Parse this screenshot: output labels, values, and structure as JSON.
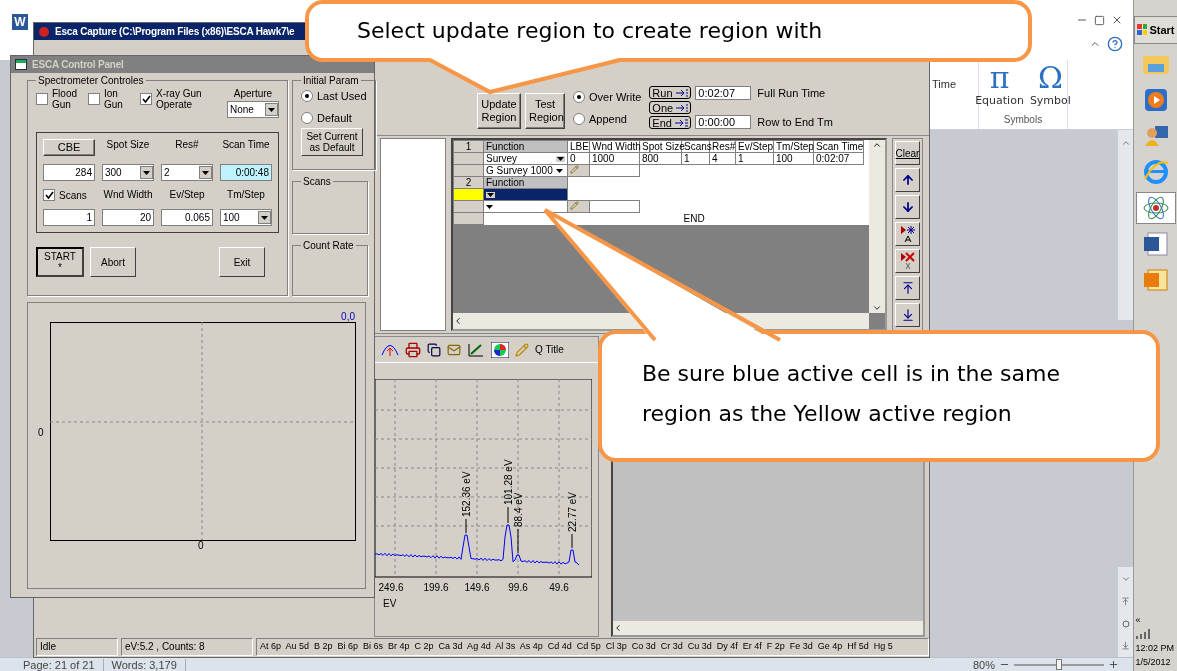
{
  "word": {
    "app_glyph": "W",
    "ribbon": {
      "partial_label": "Time",
      "buttons": [
        {
          "glyph": "π",
          "label": "Equation"
        },
        {
          "glyph": "Ω",
          "label": "Symbol"
        }
      ],
      "group": "Symbols"
    },
    "status": {
      "page": "Page: 21 of 21",
      "words": "Words: 3,179",
      "zoom": "80%",
      "zoom_slider": {
        "level": 0.5
      }
    }
  },
  "taskbar": {
    "start": "Start",
    "more": "«",
    "clock": {
      "time": "12:02 PM",
      "date": "1/5/2012"
    }
  },
  "capture": {
    "title": "Esca Capture (C:\\Program Files (x86)\\ESCA Hawk7\\e",
    "region_buttons": [
      "Update Region",
      "Test Region"
    ],
    "write_mode": [
      {
        "label": "Over Write",
        "selected": true
      },
      {
        "label": "Append",
        "selected": false
      }
    ],
    "run_buttons": [
      "Run",
      "One",
      "End"
    ],
    "full_run_time": {
      "value": "0:02:07",
      "label": "Full Run Time"
    },
    "row_to_end": {
      "value": "0:00:00",
      "label": "Row to End Tm"
    },
    "grid": {
      "columns": [
        "LBE",
        "Wnd Width",
        "Spot Size",
        "Scans",
        "Res#",
        "Ev/Step",
        "Tm/Step",
        "Scan Time"
      ],
      "regions": [
        {
          "number": "1",
          "header": "Function",
          "active": false,
          "function": "Survey",
          "values": [
            "0",
            "1000",
            "800",
            "1",
            "4",
            "1",
            "100",
            "0:02:07"
          ],
          "file": "G Survey 1000"
        },
        {
          "number": "2",
          "header": "Function",
          "active": true
        }
      ],
      "end": "END"
    },
    "side_buttons": [
      {
        "kind": "text",
        "label": "Clear"
      },
      {
        "kind": "up"
      },
      {
        "kind": "down"
      },
      {
        "kind": "insert"
      },
      {
        "kind": "delete"
      },
      {
        "kind": "top"
      },
      {
        "kind": "bottom"
      }
    ],
    "chart_toolbar": {
      "title_button": "Q Title"
    },
    "spectrum": {
      "peaks": [
        "152.36 eV",
        "101.28 eV",
        "88.4 eV",
        "22.77 eV"
      ],
      "x_ticks": [
        "249.6",
        "199.6",
        "149.6",
        "99.6",
        "49.6"
      ],
      "x_label": "EV"
    },
    "status": {
      "state": "Idle",
      "reading": "eV:5.2 , Counts: 8",
      "elements": "At 6p  Au 5d  B 2p  Bi 6p  Bi 6s  Br 4p  C 2p  Ca 3d  Ag 4d  Al 3s  As 4p  Cd 4d  Cd 5p  Cl 3p  Co 3d  Cr 3d  Cu 3d  Dy 4f  Er 4f  F 2p  Fe 3d  Ge 4p  Hf 5d  Hg 5"
    }
  },
  "control_panel": {
    "title": "ESCA Control Panel",
    "group_title": "Spectrometer Controles",
    "checkboxes": [
      {
        "label": "Flood Gun",
        "checked": false
      },
      {
        "label": "Ion Gun",
        "checked": false
      },
      {
        "label": "X-ray Gun Operate",
        "checked": true
      }
    ],
    "aperture": {
      "label": "Aperture",
      "value": "None"
    },
    "param_headers": [
      {
        "kind": "button",
        "label": "CBE"
      },
      {
        "kind": "text",
        "label": "Spot Size"
      },
      {
        "kind": "text",
        "label": "Res#"
      },
      {
        "kind": "text",
        "label": "Scan Time"
      },
      {
        "kind": "checkbox",
        "label": "Scans",
        "checked": true
      },
      {
        "kind": "text",
        "label": "Wnd Width"
      },
      {
        "kind": "text",
        "label": "Ev/Step"
      },
      {
        "kind": "text",
        "label": "Tm/Step"
      }
    ],
    "param_fields": [
      {
        "kind": "input",
        "value": "284"
      },
      {
        "kind": "select",
        "value": "300"
      },
      {
        "kind": "select",
        "value": "2"
      },
      {
        "kind": "readout",
        "value": "0:00:48"
      },
      {
        "kind": "input",
        "value": "1"
      },
      {
        "kind": "input",
        "value": "20"
      },
      {
        "kind": "input",
        "value": "0.065"
      },
      {
        "kind": "select",
        "value": "100"
      }
    ],
    "actions": [
      {
        "label": "START *",
        "default": true
      },
      {
        "label": "Abort",
        "default": false
      },
      {
        "label": "Exit",
        "default": false
      }
    ],
    "initial_param": {
      "title": "Initial Param",
      "options": [
        {
          "label": "Last Used",
          "selected": true
        },
        {
          "label": "Default",
          "selected": false
        }
      ],
      "button": "Set Current as Default"
    },
    "side_groups": [
      "Scans",
      "Count Rate"
    ],
    "plot": {
      "corner": "0,0",
      "y_label": "0",
      "x_label": "0"
    }
  },
  "callouts": [
    {
      "text": "Select update region to create region with"
    },
    {
      "text": "Be sure blue active cell is in the same region as the Yellow active region"
    }
  ]
}
